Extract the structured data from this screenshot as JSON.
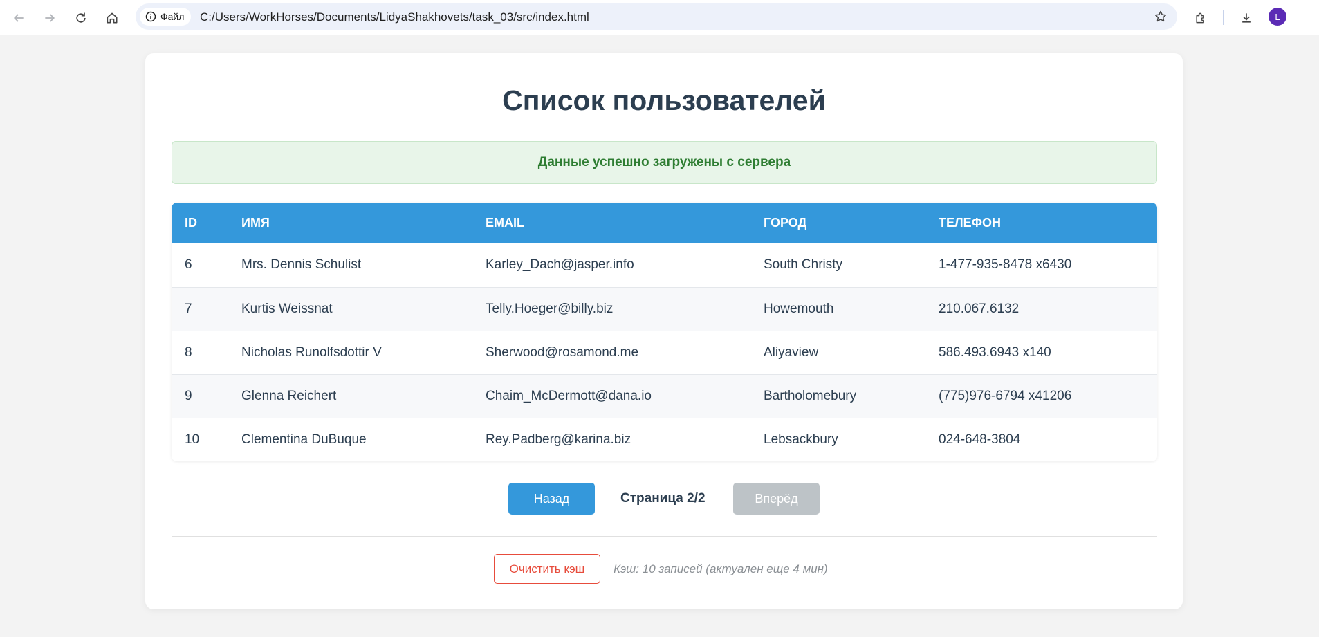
{
  "browser": {
    "chip_label": "Файл",
    "url": "C:/Users/WorkHorses/Documents/LidyaShakhovets/task_03/src/index.html",
    "avatar_letter": "L"
  },
  "page": {
    "title": "Список пользователей",
    "status_message": "Данные успешно загружены с сервера"
  },
  "table": {
    "headers": [
      "ID",
      "Имя",
      "Email",
      "Город",
      "Телефон"
    ],
    "rows": [
      {
        "id": "6",
        "name": "Mrs. Dennis Schulist",
        "email": "Karley_Dach@jasper.info",
        "city": "South Christy",
        "phone": "1-477-935-8478 x6430"
      },
      {
        "id": "7",
        "name": "Kurtis Weissnat",
        "email": "Telly.Hoeger@billy.biz",
        "city": "Howemouth",
        "phone": "210.067.6132"
      },
      {
        "id": "8",
        "name": "Nicholas Runolfsdottir V",
        "email": "Sherwood@rosamond.me",
        "city": "Aliyaview",
        "phone": "586.493.6943 x140"
      },
      {
        "id": "9",
        "name": "Glenna Reichert",
        "email": "Chaim_McDermott@dana.io",
        "city": "Bartholomebury",
        "phone": "(775)976-6794 x41206"
      },
      {
        "id": "10",
        "name": "Clementina DuBuque",
        "email": "Rey.Padberg@karina.biz",
        "city": "Lebsackbury",
        "phone": "024-648-3804"
      }
    ]
  },
  "pagination": {
    "prev_label": "Назад",
    "page_info": "Страница 2/2",
    "next_label": "Вперёд"
  },
  "cache": {
    "clear_label": "Очистить кэш",
    "info": "Кэш: 10 записей (актуален еще 4 мин)"
  },
  "colors": {
    "accent": "#3498db",
    "success_bg": "#e8f5e9",
    "success_text": "#2e7d32",
    "danger": "#e74c3c",
    "disabled": "#bdc3c7"
  }
}
